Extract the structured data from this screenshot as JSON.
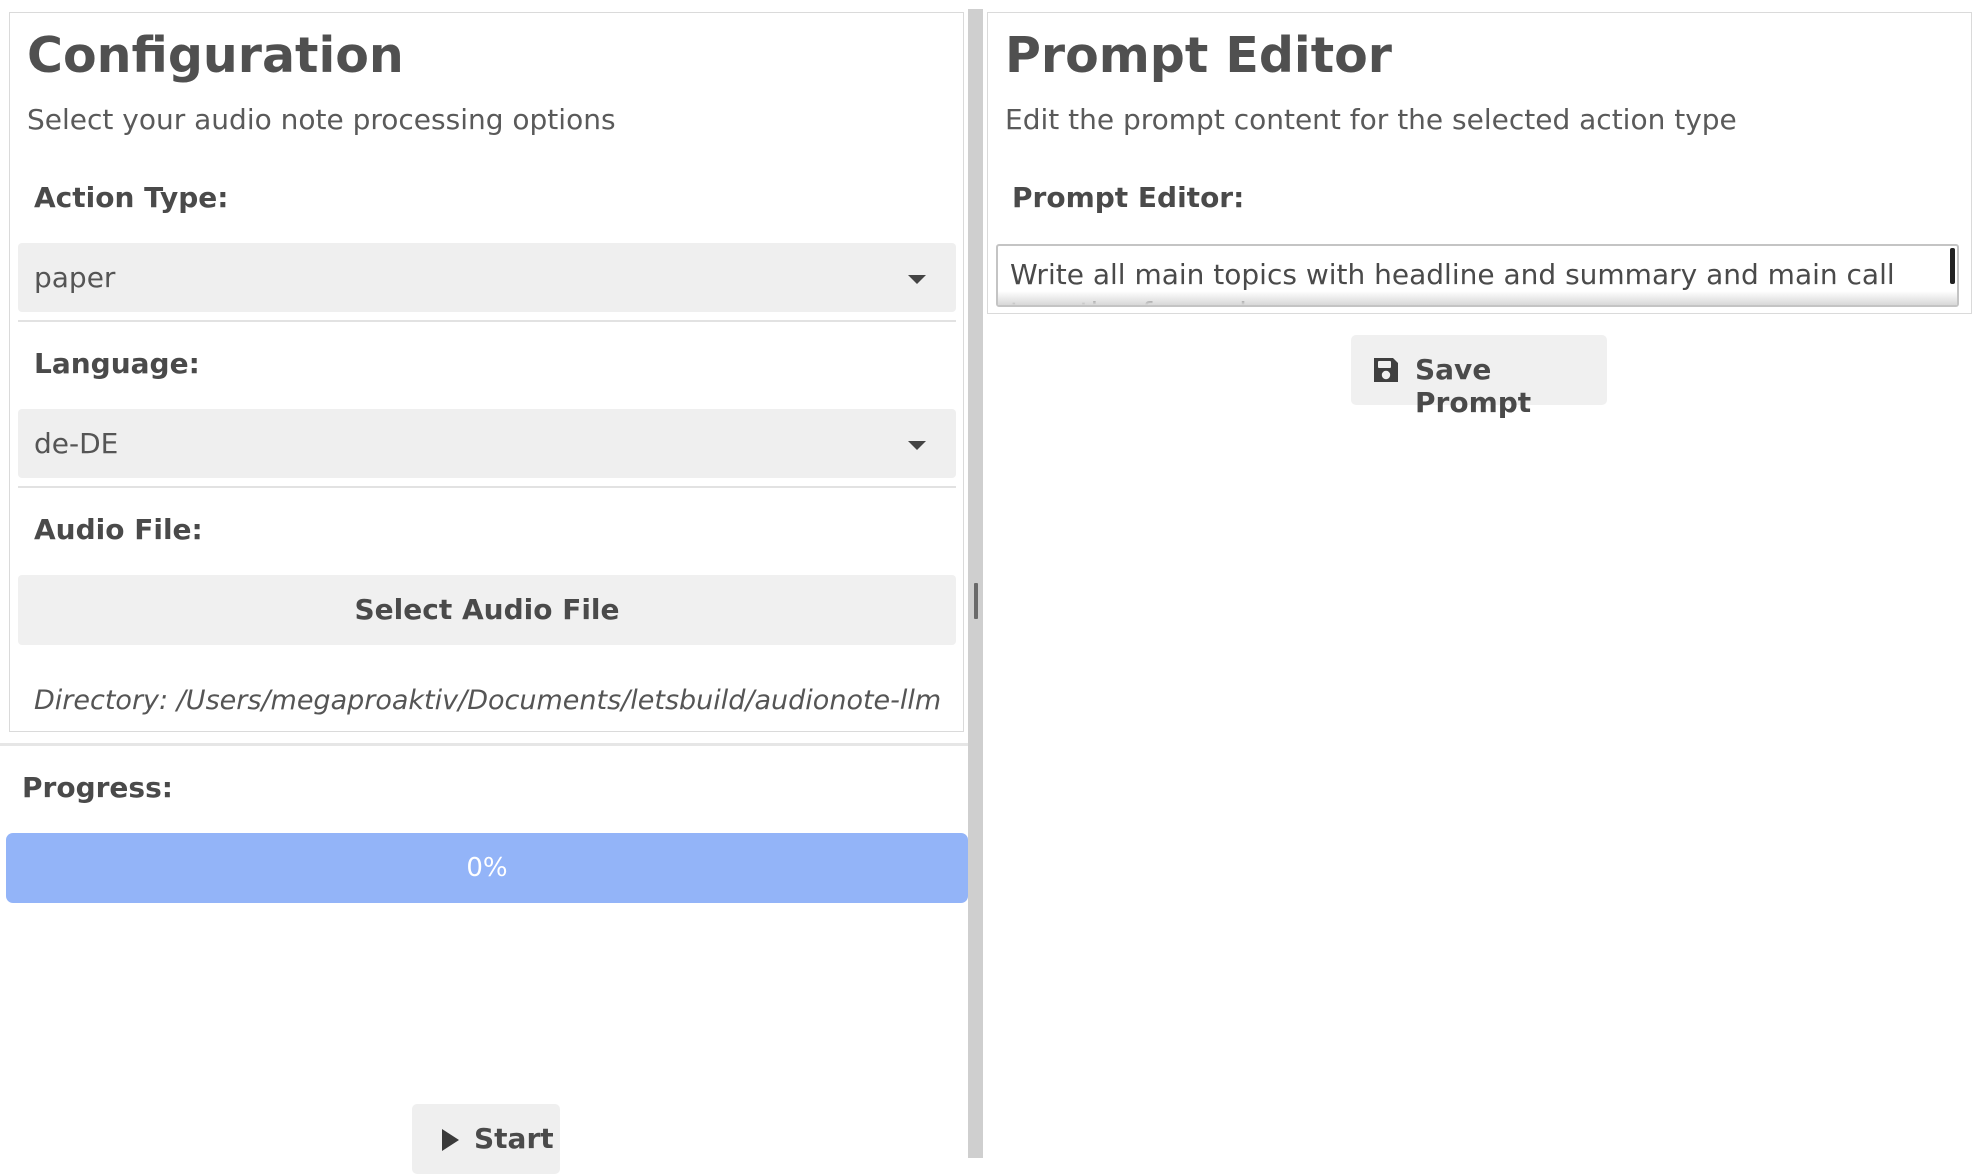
{
  "configuration": {
    "title": "Configuration",
    "subtitle": "Select your audio note processing options",
    "action_type": {
      "label": "Action Type:",
      "value": "paper"
    },
    "language": {
      "label": "Language:",
      "value": "de-DE"
    },
    "audio_file": {
      "label": "Audio File:",
      "button_label": "Select Audio File",
      "directory": "Directory: /Users/megaproaktiv/Documents/letsbuild/audionote-llm"
    }
  },
  "progress": {
    "label": "Progress:",
    "value_text": "0%",
    "value": 0,
    "track_color": "#93b4f8"
  },
  "start_button": {
    "label": "Start",
    "icon": "play-icon"
  },
  "prompt_editor": {
    "title": "Prompt Editor",
    "subtitle": "Edit the prompt content for the selected action type",
    "label": "Prompt Editor:",
    "content": "Write all main topics with headline and summary and main call to action for each",
    "save_button_label": "Save Prompt",
    "save_icon": "floppy-disk-icon"
  }
}
